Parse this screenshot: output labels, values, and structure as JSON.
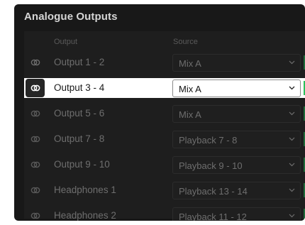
{
  "section": {
    "title": "Analogue Outputs",
    "columns": {
      "output": "Output",
      "source": "Source"
    }
  },
  "icons": {
    "link": "link-rings-icon",
    "dropdown": "chevron-down-icon"
  },
  "colors": {
    "panel_bg": "#181818",
    "active_row_bg": "#ffffff",
    "accent_green": "#2bbf5b"
  },
  "rows": [
    {
      "output": "Output 1 - 2",
      "source": "Mix A",
      "active": false
    },
    {
      "output": "Output 3 - 4",
      "source": "Mix A",
      "active": true
    },
    {
      "output": "Output 5 - 6",
      "source": "Mix A",
      "active": false
    },
    {
      "output": "Output 7 - 8",
      "source": "Playback 7 - 8",
      "active": false
    },
    {
      "output": "Output 9 - 10",
      "source": "Playback 9 - 10",
      "active": false
    },
    {
      "output": "Headphones 1",
      "source": "Playback 13 - 14",
      "active": false
    },
    {
      "output": "Headphones 2",
      "source": "Playback 11 - 12",
      "active": false
    }
  ]
}
